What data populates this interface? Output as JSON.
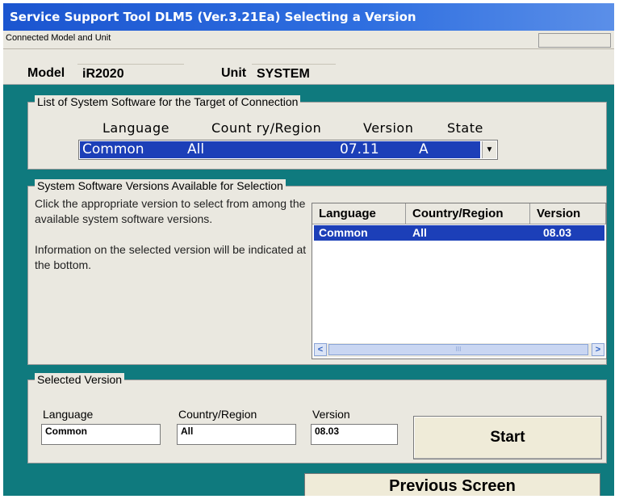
{
  "window": {
    "title": "Service Support Tool DLM5 (Ver.3.21Ea) Selecting a Version"
  },
  "connection": {
    "label": "Connected Model and Unit",
    "model_label": "Model",
    "model_value": "iR2020",
    "unit_label": "Unit",
    "unit_value": "SYSTEM"
  },
  "target": {
    "legend": "List of System Software for the Target of Connection",
    "headers": {
      "language": "Language",
      "country": "Count ry/Region",
      "version": "Version",
      "state": "State"
    },
    "selected": {
      "language": "Common",
      "country": "All",
      "version": "07.11",
      "state": "A"
    },
    "dropdown_icon": "chevron-down-icon"
  },
  "available": {
    "legend": "System Software Versions Available for Selection",
    "description": "Click the appropriate version to select from among the available system software versions.\n\nInformation on the selected version will be indicated at the bottom.",
    "columns": [
      "Language",
      "Country/Region",
      "Version"
    ],
    "rows": [
      {
        "language": "Common",
        "country": "All",
        "version": "08.03"
      }
    ],
    "scroll_left_icon": "scroll-left-icon",
    "scroll_right_icon": "scroll-right-icon",
    "scroll_grip": "III"
  },
  "selected_version": {
    "legend": "Selected Version",
    "language_label": "Language",
    "language_value": "Common",
    "country_label": "Country/Region",
    "country_value": "All",
    "version_label": "Version",
    "version_value": "08.03"
  },
  "buttons": {
    "start": "Start",
    "previous": "Previous Screen"
  },
  "colors": {
    "titlebar": "#2f6fe0",
    "background": "#0f7a7e",
    "selection": "#1c3fb8",
    "panel": "#eae8e0"
  }
}
